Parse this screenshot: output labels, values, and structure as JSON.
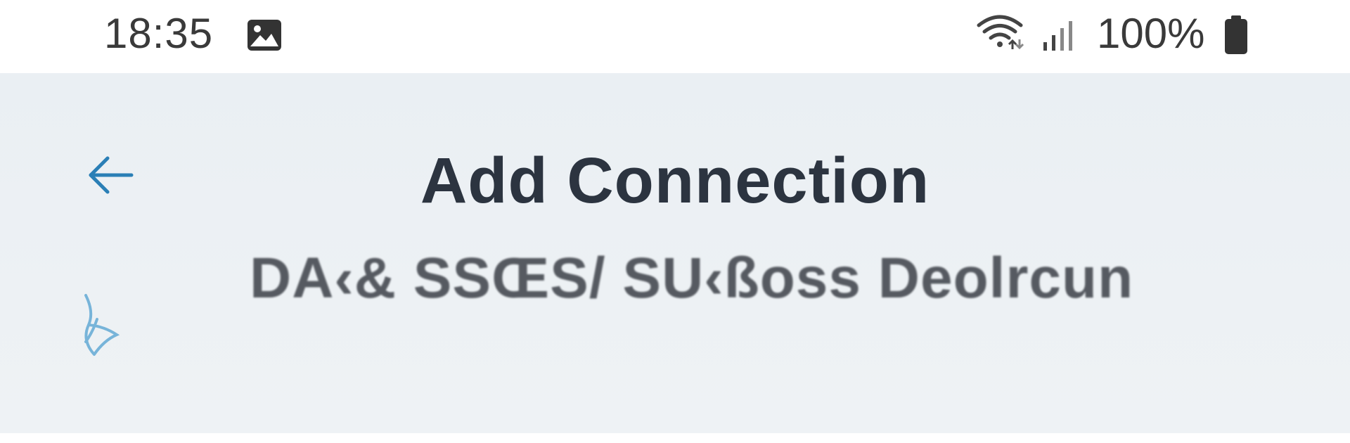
{
  "status_bar": {
    "time": "18:35",
    "battery": "100%",
    "icons": [
      "image-icon",
      "wifi-icon",
      "signal-icon",
      "battery-icon"
    ]
  },
  "header": {
    "title": "Add Connection",
    "subtitle": "DA‹& SSŒS/ SU‹ßoss Deolrcun",
    "back_icon": "arrow-left-icon",
    "side_icon": "share-icon"
  },
  "colors": {
    "accent": "#2a7fb6",
    "header_bg": "#ecf0f3",
    "title": "#2c3440",
    "status_text": "#3a3a3a"
  }
}
